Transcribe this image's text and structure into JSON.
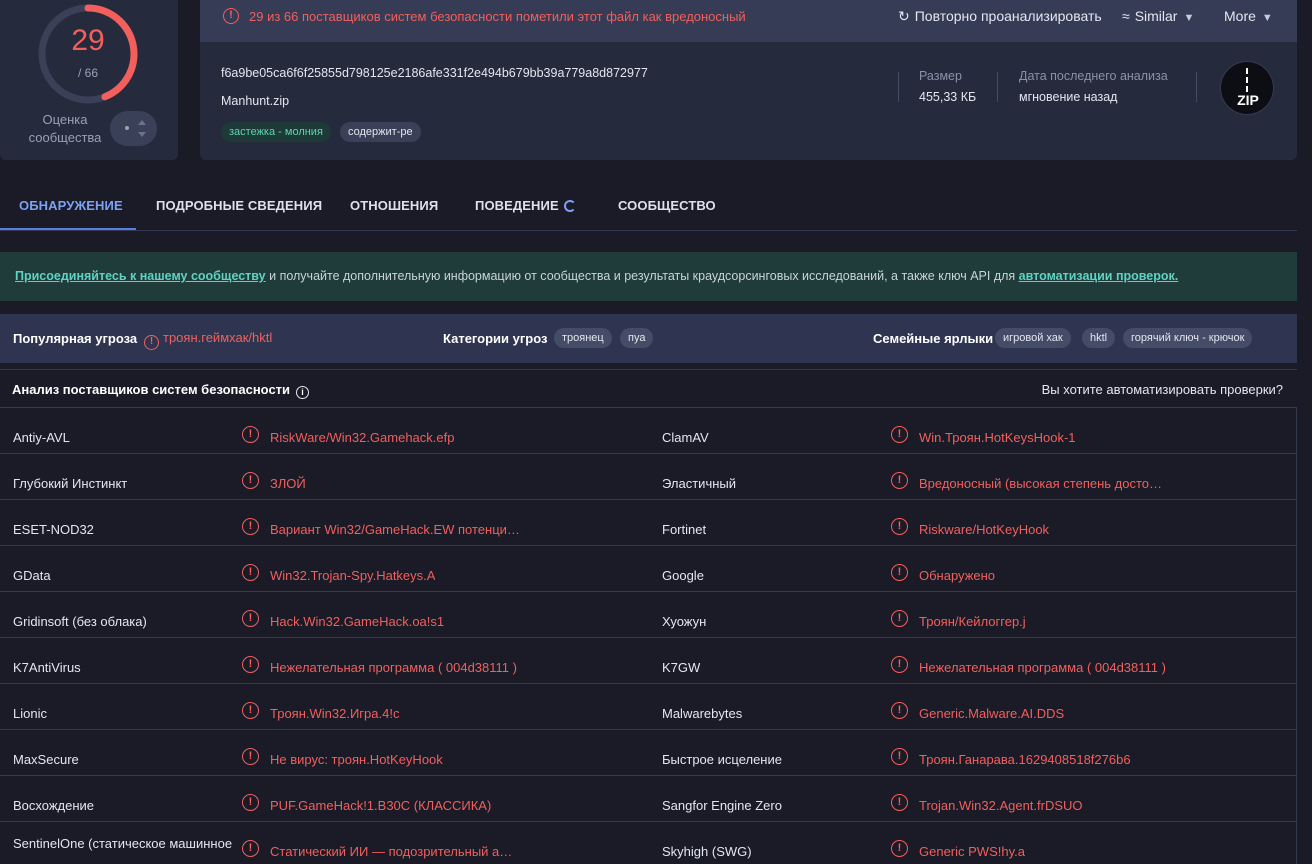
{
  "score": {
    "detected": "29",
    "total": "/ 66",
    "detected_fraction": 0.4394,
    "community_label": "Оценка сообщества",
    "color": "#f25f5c"
  },
  "alert": {
    "text": "29 из 66 поставщиков систем безопасности пометили этот файл как вредоносный"
  },
  "header_buttons": {
    "reanalyze": "Повторно проанализировать",
    "similar": "Similar",
    "more": "More"
  },
  "file": {
    "hash": "f6a9be05ca6f6f25855d798125e2186afe331f2e494b679bb39a779a8d872977",
    "name": "Manhunt.zip",
    "tags": [
      "застежка - молния",
      "содержит-ре"
    ],
    "size_label": "Размер",
    "size_value": "455,33 КБ",
    "date_label": "Дата последнего анализа",
    "date_value": "мгновение назад",
    "type_badge": "ZIP"
  },
  "tabs": [
    "ОБНАРУЖЕНИЕ",
    "ПОДРОБНЫЕ СВЕДЕНИЯ",
    "ОТНОШЕНИЯ",
    "ПОВЕДЕНИЕ",
    "СООБЩЕСТВО"
  ],
  "banner": {
    "link1": "Присоединяйтесь к нашему сообществу",
    "middle": " и получайте дополнительную информацию от сообщества и результаты краудсорсинговых исследований, а также ключ API для ",
    "link2": "автоматизации проверок."
  },
  "threat": {
    "popular_label": "Популярная угроза",
    "popular_value": "троян.геймхак/hktl",
    "categories_label": "Категории угроз",
    "categories": [
      "троянец",
      "пуа"
    ],
    "family_label": "Семейные ярлыки",
    "family": [
      "игровой хак",
      "hktl",
      "горячий ключ - крючок"
    ]
  },
  "vendors_section": {
    "title": "Анализ поставщиков систем безопасности",
    "automate": "Вы хотите автоматизировать проверки?"
  },
  "vendors": [
    {
      "left_name": "Antiy-AVL",
      "left_result": "RiskWare/Win32.Gamehack.efp",
      "right_name": "ClamAV",
      "right_result": "Win.Троян.HotKeysHook-1"
    },
    {
      "left_name": "Глубокий Инстинкт",
      "left_result": "ЗЛОЙ",
      "right_name": "Эластичный",
      "right_result": "Вредоносный (высокая степень досто…"
    },
    {
      "left_name": "ESET-NOD32",
      "left_result": "Вариант Win32/GameHack.EW потенци…",
      "right_name": "Fortinet",
      "right_result": "Riskware/HotKeyHook"
    },
    {
      "left_name": "GData",
      "left_result": "Win32.Trojan-Spy.Hatkeys.A",
      "right_name": "Google",
      "right_result": "Обнаружено"
    },
    {
      "left_name": "Gridinsoft (без облака)",
      "left_result": "Hack.Win32.GameHack.oa!s1",
      "right_name": "Хуожун",
      "right_result": "Троян/Кейлоггер.j"
    },
    {
      "left_name": "K7AntiVirus",
      "left_result": "Нежелательная программа ( 004d38111 )",
      "right_name": "K7GW",
      "right_result": "Нежелательная программа ( 004d38111 )"
    },
    {
      "left_name": "Lionic",
      "left_result": "Троян.Win32.Игра.4!c",
      "right_name": "Malwarebytes",
      "right_result": "Generic.Malware.AI.DDS"
    },
    {
      "left_name": "MaxSecure",
      "left_result": "Не вирус: троян.HotKeyHook",
      "right_name": "Быстрое исцеление",
      "right_result": "Троян.Ганарава.1629408518f276b6"
    },
    {
      "left_name": "Восхождение",
      "left_result": "PUF.GameHack!1.B30C (КЛАССИКА)",
      "right_name": "Sangfor Engine Zero",
      "right_result": "Trojan.Win32.Agent.frDSUO"
    },
    {
      "left_name": "SentinelOne (статическое машинное",
      "left_result": "Статический ИИ — подозрительный а…",
      "right_name": "Skyhigh (SWG)",
      "right_result": "Generic PWS!hy.a"
    }
  ]
}
